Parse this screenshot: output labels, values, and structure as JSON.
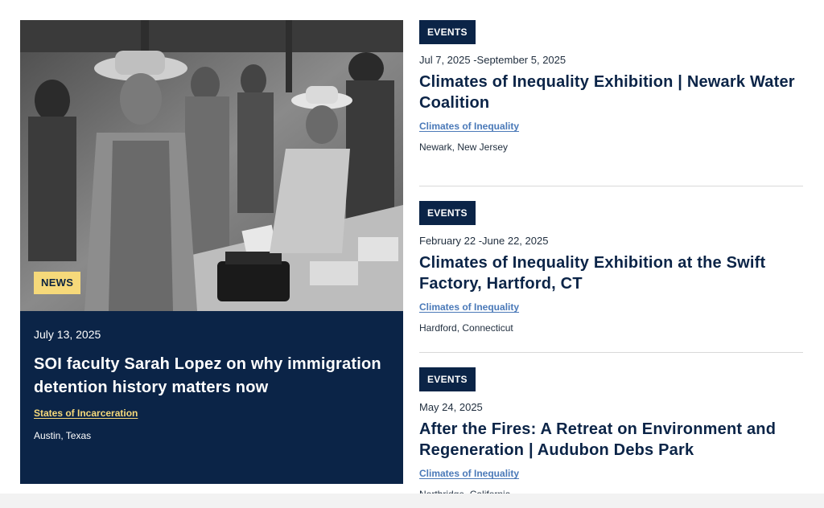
{
  "feature": {
    "badge": "NEWS",
    "date": "July 13, 2025",
    "title": "SOI faculty Sarah Lopez on why immigration detention history matters now",
    "tag": "States of Incarceration",
    "location": "Austin, Texas",
    "colors": {
      "card_bg": "#0b2447",
      "badge_bg": "#f6d97a",
      "tag": "#f6d97a"
    },
    "image": "historical-black-and-white-photo-workers-with-typewriters"
  },
  "events": [
    {
      "badge": "EVENTS",
      "date": "Jul 7, 2025 -September 5, 2025",
      "title": "Climates of Inequality Exhibition | Newark Water Coalition",
      "tag": "Climates of Inequality",
      "location": "Newark, New Jersey"
    },
    {
      "badge": "EVENTS",
      "date": "February 22 -June 22, 2025",
      "title": "Climates of Inequality Exhibition at the Swift Factory, Hartford, CT",
      "tag": "Climates of Inequality",
      "location": "Hardford, Connecticut"
    },
    {
      "badge": "EVENTS",
      "date": "May 24, 2025",
      "title": "After the Fires: A Retreat on Environment and Regeneration | Audubon Debs Park",
      "tag": "Climates of Inequality",
      "location": "Northridge, California"
    }
  ],
  "colors": {
    "navy": "#0b2447",
    "link_blue": "#4a79b8",
    "divider": "#d9d9d9"
  }
}
